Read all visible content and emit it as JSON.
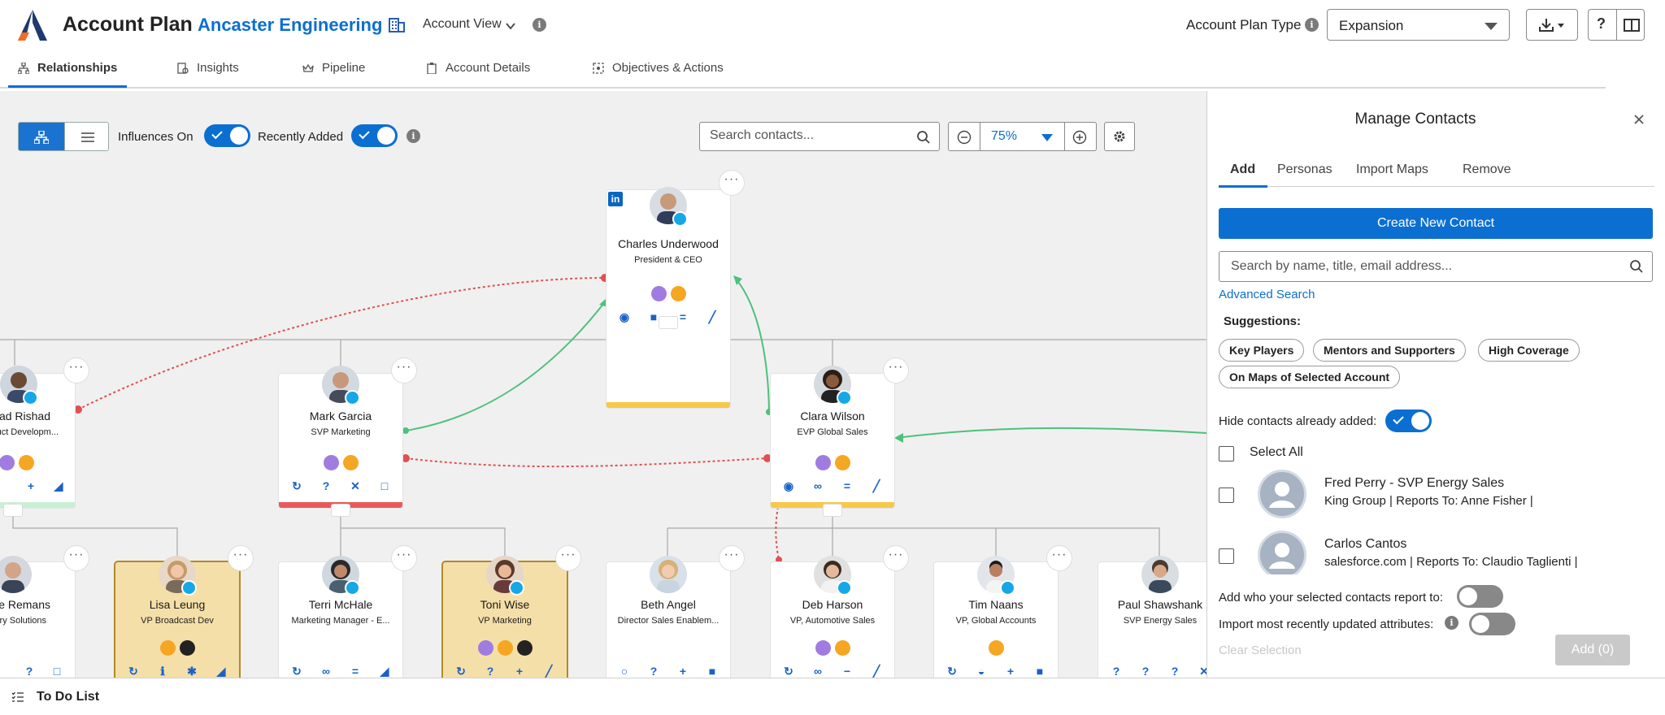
{
  "app": {
    "title": "Account Plan",
    "account_name": "Ancaster Engineering",
    "view_label": "Account View"
  },
  "plan_type": {
    "label": "Account Plan Type",
    "value": "Expansion"
  },
  "tabs": [
    {
      "label": "Relationships",
      "icon": "hierarchy-icon"
    },
    {
      "label": "Insights",
      "icon": "insights-icon"
    },
    {
      "label": "Pipeline",
      "icon": "crown-icon"
    },
    {
      "label": "Account Details",
      "icon": "clipboard-icon"
    },
    {
      "label": "Objectives & Actions",
      "icon": "target-icon"
    }
  ],
  "canvas": {
    "influences_label": "Influences On",
    "recently_added_label": "Recently Added",
    "influences_on": true,
    "recently_added_on": true,
    "search_placeholder": "Search contacts...",
    "zoom": "75%"
  },
  "contacts": [
    {
      "name": "Charles Underwood",
      "title": "President & CEO"
    },
    {
      "name": "ad Rishad",
      "title": "uct Developm..."
    },
    {
      "name": "Mark Garcia",
      "title": "SVP Marketing"
    },
    {
      "name": "Clara Wilson",
      "title": "EVP Global Sales"
    },
    {
      "name": "e Remans",
      "title": "stry Solutions"
    },
    {
      "name": "Lisa Leung",
      "title": "VP Broadcast Dev"
    },
    {
      "name": "Terri McHale",
      "title": "Marketing Manager - E..."
    },
    {
      "name": "Toni Wise",
      "title": "VP Marketing"
    },
    {
      "name": "Beth Angel",
      "title": "Director Sales Enablem..."
    },
    {
      "name": "Deb Harson",
      "title": "VP, Automotive Sales"
    },
    {
      "name": "Tim Naans",
      "title": "VP, Global Accounts"
    },
    {
      "name": "Paul Shawshank",
      "title": "SVP Energy Sales"
    }
  ],
  "panel": {
    "title": "Manage Contacts",
    "tabs": [
      "Add",
      "Personas",
      "Import Maps",
      "Remove"
    ],
    "create_label": "Create New Contact",
    "search_placeholder": "Search by name, title, email address...",
    "advanced_search": "Advanced Search",
    "suggestions_label": "Suggestions:",
    "chips": [
      "Key Players",
      "Mentors and Supporters",
      "High Coverage",
      "On Maps of Selected Account"
    ],
    "hide_label": "Hide contacts already added:",
    "hide_on": true,
    "select_all": "Select All",
    "results": [
      {
        "name": "Fred Perry  - SVP Energy Sales",
        "sub": "King Group | Reports To: Anne Fisher |"
      },
      {
        "name": "Carlos Cantos",
        "sub": "salesforce.com | Reports To: Claudio Taglienti |"
      }
    ],
    "report_to_label": "Add who your selected contacts report to:",
    "import_label": "Import most recently updated attributes:",
    "clear_label": "Clear Selection",
    "add_label": "Add (0)"
  },
  "todo_label": "To Do List",
  "colors": {
    "accent": "#0b6fd2",
    "yellow": "#f7c948",
    "red": "#e85a5a",
    "green": "#4cc27a",
    "highlight": "#f5dfa8"
  }
}
